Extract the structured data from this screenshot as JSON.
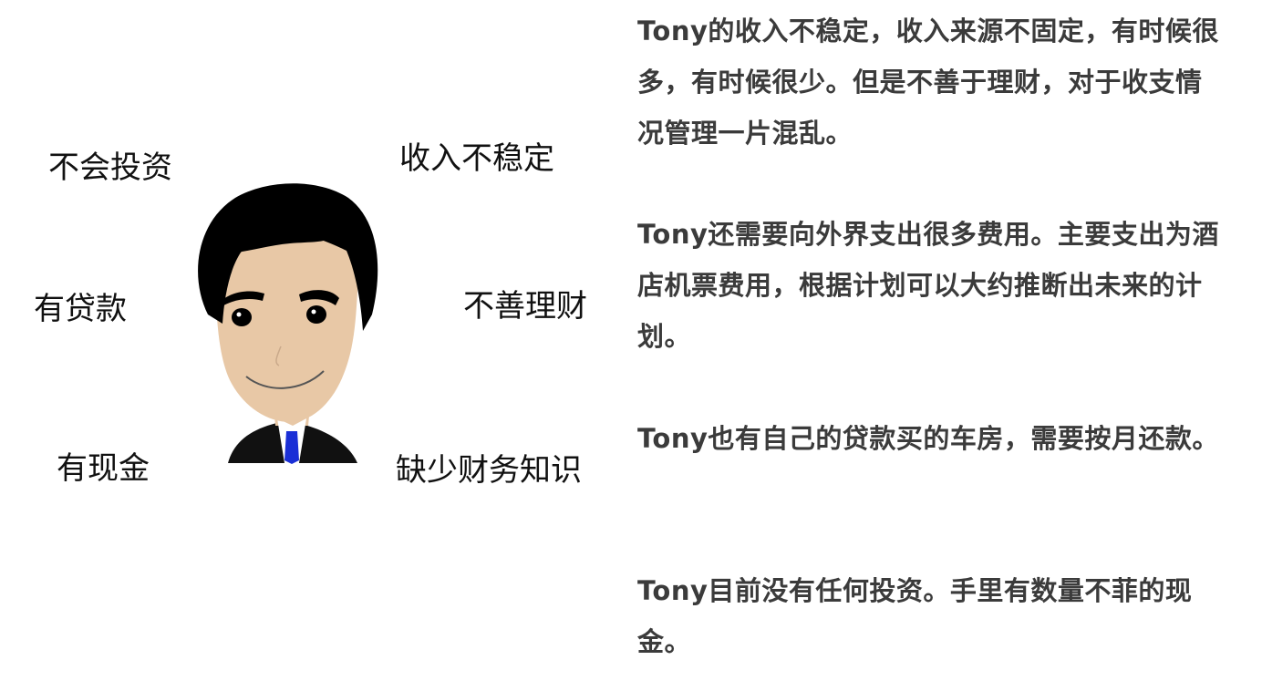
{
  "traits": {
    "no_invest": "不会投资",
    "unstable_income": "收入不稳定",
    "has_loan": "有贷款",
    "poor_finance_management": "不善理财",
    "has_cash": "有现金",
    "lack_finance_knowledge": "缺少财务知识"
  },
  "descriptions": [
    "Tony的收入不稳定，收入来源不固定，有时候很多，有时候很少。但是不善于理财，对于收支情况管理一片混乱。",
    "Tony还需要向外界支出很多费用。主要支出为酒店机票费用，根据计划可以大约推断出未来的计划。",
    "Tony也有自己的贷款买的车房，需要按月还款。",
    "Tony目前没有任何投资。手里有数量不菲的现金。"
  ],
  "colors": {
    "hair": "#000000",
    "skin": "#e8c8a6",
    "suit": "#111111",
    "shirt": "#ffffff",
    "tie": "#1a2fd6",
    "text_main": "#111111",
    "text_desc": "#3b3b3b"
  },
  "icons": {
    "avatar": "businessman-avatar-icon"
  }
}
